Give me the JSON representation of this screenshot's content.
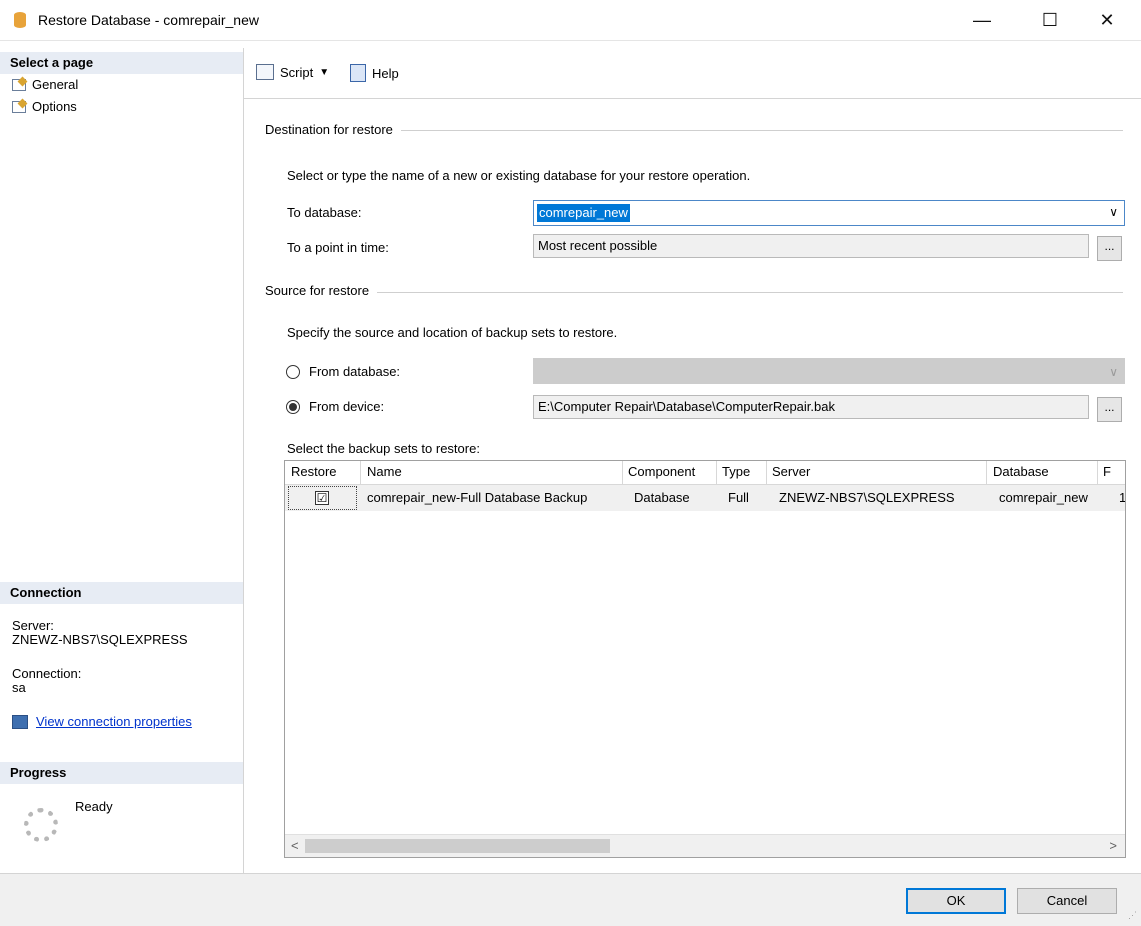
{
  "window": {
    "title": "Restore Database - comrepair_new",
    "minimize": "—",
    "maximize": "☐",
    "close": "✕"
  },
  "sidebar": {
    "select_page_header": "Select a page",
    "pages": [
      {
        "label": "General",
        "icon": "page-icon"
      },
      {
        "label": "Options",
        "icon": "page-icon"
      }
    ],
    "connection_header": "Connection",
    "server_label": "Server:",
    "server_value": "ZNEWZ-NBS7\\SQLEXPRESS",
    "connection_label": "Connection:",
    "connection_value": "sa",
    "view_connection_link": "View connection properties",
    "progress_header": "Progress",
    "progress_status": "Ready"
  },
  "toolbar": {
    "script_label": "Script",
    "help_label": "Help"
  },
  "destination": {
    "group_label": "Destination for restore",
    "instruction": "Select or type the name of a new or existing database for your restore operation.",
    "to_database_label": "To database:",
    "to_database_value": "comrepair_new",
    "point_in_time_label": "To a point in time:",
    "point_in_time_value": "Most recent possible",
    "ellipsis": "..."
  },
  "source": {
    "group_label": "Source for restore",
    "instruction": "Specify the source and location of backup sets to restore.",
    "from_database_label": "From database:",
    "from_database_value": "",
    "from_device_label": "From device:",
    "from_device_value": "E:\\Computer Repair\\Database\\ComputerRepair.bak",
    "selected_option": "From device",
    "ellipsis": "..."
  },
  "backup_sets": {
    "label": "Select the backup sets to restore:",
    "columns": [
      "Restore",
      "Name",
      "Component",
      "Type",
      "Server",
      "Database",
      "F"
    ],
    "rows": [
      {
        "restore": "☑",
        "name": "comrepair_new-Full Database Backup",
        "component": "Database",
        "type": "Full",
        "server": "ZNEWZ-NBS7\\SQLEXPRESS",
        "database": "comrepair_new",
        "extra": "1"
      }
    ],
    "scroll_left": "<",
    "scroll_right": ">"
  },
  "buttons": {
    "ok": "OK",
    "cancel": "Cancel"
  },
  "colors": {
    "accent": "#0078d7",
    "selection": "#0078d7",
    "header_band": "#e7ecf4",
    "link": "#0033cc"
  }
}
